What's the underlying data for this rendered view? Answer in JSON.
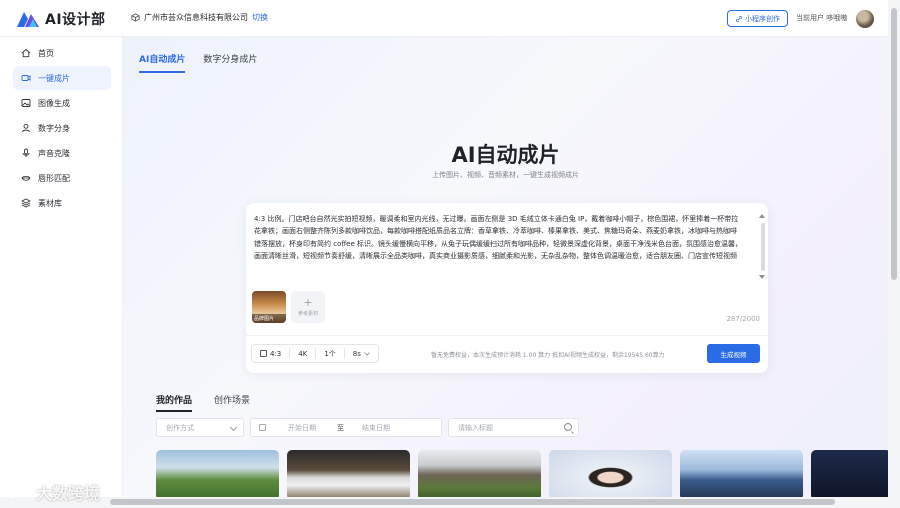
{
  "header": {
    "app_title": "AI设计部",
    "company": "广州市芸众信息科技有限公司",
    "switch_label": "切换",
    "mini_program_label": "小程序创作",
    "current_user": "当前用户 哆哦嗷"
  },
  "sidebar": {
    "items": [
      {
        "label": "首页",
        "icon": "home-icon"
      },
      {
        "label": "一键成片",
        "icon": "video-icon",
        "active": true
      },
      {
        "label": "图像生成",
        "icon": "image-icon"
      },
      {
        "label": "数字分身",
        "icon": "person-icon"
      },
      {
        "label": "声音克隆",
        "icon": "mic-icon"
      },
      {
        "label": "唇形匹配",
        "icon": "lips-icon"
      },
      {
        "label": "素材库",
        "icon": "layers-icon"
      }
    ]
  },
  "main": {
    "tabs": [
      {
        "label": "AI自动成片",
        "active": true
      },
      {
        "label": "数字分身成片"
      }
    ],
    "hero_title": "AI自动成片",
    "hero_subtitle": "上传图片、视频、音频素材，一键生成视频成片",
    "prompt_text": "4:3 比例。门店吧台自然光实拍短视频，暖调柔和室内光线，无过曝。画面左侧是 3D 毛绒立体卡通白兔 IP，戴着咖啡小帽子，棕色围裙，怀里捧着一杯带拉花拿铁；画面右侧整齐陈列多款咖啡饮品，每款咖啡搭配纸质品名立牌：香草拿铁、冷萃咖啡、榛果拿铁、美式、焦糖玛奇朵、燕麦奶拿铁，冰咖啡与热咖啡错落摆放，杯身印有简约 coffee 标识。镜头缓慢横向平移，从兔子玩偶缓缓扫过所有咖啡品种，轻微景深虚化背景，桌面干净浅米色台面，氛围感治愈温馨，画面清晰丝滑，短视频节奏舒缓，清晰展示全品类咖啡，真实商业摄影质感，细腻柔和光影，无杂乱杂物，整体色调温暖治愈，适合朋友圈、门店宣传短视频",
    "thumb_caption": "品牌图片",
    "add_ref_label": "参考素材",
    "char_count": "287/2000",
    "options": {
      "ratio": "4:3",
      "resolution": "4K",
      "quantity": "1个",
      "duration": "8s"
    },
    "tip": "暂无免费权益，本次生成预计消耗 1.00 算力 抵扣AI视频生成权益，剩余19545.60算力",
    "generate_label": "生成视频",
    "works_tabs": [
      {
        "label": "我的作品",
        "active": true
      },
      {
        "label": "创作场景"
      }
    ],
    "filter": {
      "method_placeholder": "创作方式",
      "start_date_placeholder": "开始日期",
      "date_separator": "至",
      "end_date_placeholder": "结束日期",
      "search_placeholder": "请输入标题"
    }
  },
  "watermark": "大数跨境",
  "colors": {
    "accent": "#2b6be6",
    "sidebar_active_bg": "#eef3fd"
  }
}
